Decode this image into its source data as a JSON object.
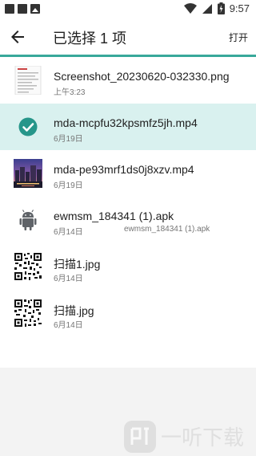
{
  "status_bar": {
    "time": "9:57",
    "icons": [
      "notification-square-icon",
      "notification-square-icon",
      "image-notification-icon",
      "wifi-icon",
      "signal-icon",
      "battery-charging-icon"
    ]
  },
  "toolbar": {
    "title": "已选择 1 项",
    "open_label": "打开",
    "accent_color": "#38a89a"
  },
  "files": [
    {
      "name": "Screenshot_20230620-032330.png",
      "date": "上午3:23",
      "summary": "",
      "thumb": "screenshot-thumbnail",
      "selected": false
    },
    {
      "name": "mda-mcpfu32kpsmfz5jh.mp4",
      "date": "6月19日",
      "summary": "",
      "thumb": "check-circle-icon",
      "selected": true
    },
    {
      "name": "mda-pe93mrf1ds0j8xzv.mp4",
      "date": "6月19日",
      "summary": "",
      "thumb": "video-thumbnail",
      "selected": false
    },
    {
      "name": "ewmsm_184341 (1).apk",
      "date": "6月14日",
      "summary": "ewmsm_184341 (1).apk",
      "thumb": "android-icon",
      "selected": false
    },
    {
      "name": "扫描1.jpg",
      "date": "6月14日",
      "summary": "",
      "thumb": "qr-code-thumbnail",
      "selected": false
    },
    {
      "name": "扫描.jpg",
      "date": "6月14日",
      "summary": "",
      "thumb": "qr-code-thumbnail",
      "selected": false
    }
  ],
  "watermark": {
    "text": "一听下载"
  }
}
